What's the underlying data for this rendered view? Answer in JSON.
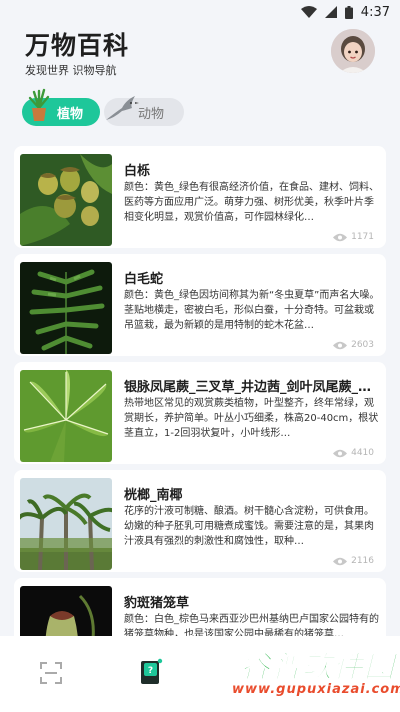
{
  "status": {
    "time": "4:37"
  },
  "header": {
    "title": "万物百科",
    "subtitle": "发现世界 识物导航"
  },
  "tabs": [
    {
      "label": "植物",
      "active": true
    },
    {
      "label": "动物",
      "active": false
    }
  ],
  "items": [
    {
      "name": "白栎",
      "desc": "颜色：黄色_绿色有很高经济价值，在食品、建材、饲料、医药等方面应用广泛。萌芽力强、树形优美，秋季叶片季相变化明显，观赏价值高，可作园林绿化…",
      "views": "1171",
      "image": "acorn"
    },
    {
      "name": "白毛蛇",
      "desc": "颜色：黄色_绿色因坊间称其为新“冬虫夏草”而声名大噪。茎贴地横走，密被白毛，形似白蚕，十分奇特。可盆栽或吊篮栽，最为新颖的是用特制的蛇木花盆…",
      "views": "2603",
      "image": "fern-dark"
    },
    {
      "name": "银脉凤尾蕨_三叉草_井边茜_剑叶凤尾蕨_…",
      "desc": "热带地区常见的观赏蕨类植物，叶型整齐，终年常绿，观赏期长，养护简单。叶丛小巧细柔，株高20-40cm，根状茎直立，1-2回羽状复叶，小叶线形…",
      "views": "4410",
      "image": "fern-green"
    },
    {
      "name": "桄榔_南椰",
      "desc": "花序的汁液可制糖、酿酒。树干髓心含淀粉，可供食用。幼嫩的种子胚乳可用糖煮成蜜饯。需要注意的是，其果肉汁液具有强烈的刺激性和腐蚀性，取种…",
      "views": "2116",
      "image": "palm"
    },
    {
      "name": "豹斑猪笼草",
      "desc": "颜色：白色_棕色马来西亚沙巴州基纳巴卢国家公园特有的猪笼草物种，也是该国家公园中最稀有的猪笼草…",
      "views": "",
      "image": "pitcher"
    }
  ],
  "bottom_nav": [
    {
      "name": "scan",
      "icon": "scan-icon"
    },
    {
      "name": "encyclopedia",
      "icon": "book-icon"
    }
  ],
  "watermark": {
    "text": "谷普软件园",
    "url": "www.gupuxiazai.com"
  },
  "colors": {
    "accent": "#1ec79a",
    "background": "#f3f5f9"
  }
}
